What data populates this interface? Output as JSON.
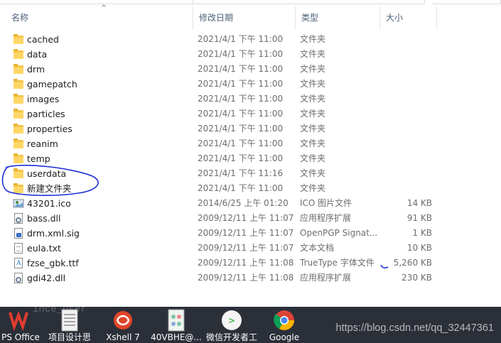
{
  "columns": {
    "name": "名称",
    "date": "修改日期",
    "type": "类型",
    "size": "大小"
  },
  "files": [
    {
      "name": "cached",
      "date": "2021/4/1 下午 11:00",
      "type": "文件夹",
      "size": "",
      "icon": "folder-icon"
    },
    {
      "name": "data",
      "date": "2021/4/1 下午 11:00",
      "type": "文件夹",
      "size": "",
      "icon": "folder-icon"
    },
    {
      "name": "drm",
      "date": "2021/4/1 下午 11:00",
      "type": "文件夹",
      "size": "",
      "icon": "folder-icon"
    },
    {
      "name": "gamepatch",
      "date": "2021/4/1 下午 11:00",
      "type": "文件夹",
      "size": "",
      "icon": "folder-icon"
    },
    {
      "name": "images",
      "date": "2021/4/1 下午 11:00",
      "type": "文件夹",
      "size": "",
      "icon": "folder-icon"
    },
    {
      "name": "particles",
      "date": "2021/4/1 下午 11:00",
      "type": "文件夹",
      "size": "",
      "icon": "folder-icon"
    },
    {
      "name": "properties",
      "date": "2021/4/1 下午 11:00",
      "type": "文件夹",
      "size": "",
      "icon": "folder-icon"
    },
    {
      "name": "reanim",
      "date": "2021/4/1 下午 11:00",
      "type": "文件夹",
      "size": "",
      "icon": "folder-icon"
    },
    {
      "name": "temp",
      "date": "2021/4/1 下午 11:00",
      "type": "文件夹",
      "size": "",
      "icon": "folder-icon"
    },
    {
      "name": "userdata",
      "date": "2021/4/1 下午 11:16",
      "type": "文件夹",
      "size": "",
      "icon": "folder-icon"
    },
    {
      "name": "新建文件夹",
      "date": "2021/4/1 下午 11:00",
      "type": "文件夹",
      "size": "",
      "icon": "folder-icon"
    },
    {
      "name": "43201.ico",
      "date": "2014/6/25 上午 01:20",
      "type": "ICO 图片文件",
      "size": "14 KB",
      "icon": "ico-file-icon"
    },
    {
      "name": "bass.dll",
      "date": "2009/12/11 上午 11:07",
      "type": "应用程序扩展",
      "size": "91 KB",
      "icon": "dll-file-icon"
    },
    {
      "name": "drm.xml.sig",
      "date": "2009/12/11 上午 11:07",
      "type": "OpenPGP Signat...",
      "size": "1 KB",
      "icon": "signature-file-icon"
    },
    {
      "name": "eula.txt",
      "date": "2009/12/11 上午 11:07",
      "type": "文本文档",
      "size": "10 KB",
      "icon": "text-file-icon"
    },
    {
      "name": "fzse_gbk.ttf",
      "date": "2009/12/11 上午 11:08",
      "type": "TrueType 字体文件",
      "size": "5,260 KB",
      "icon": "font-file-icon"
    },
    {
      "name": "gdi42.dll",
      "date": "2009/12/11 上午 11:08",
      "type": "应用程序扩展",
      "size": "230 KB",
      "icon": "dll-file-icon"
    }
  ],
  "taskbar": [
    {
      "label": "PS Office",
      "icon": "wps-office-icon",
      "color": "#e23c2f"
    },
    {
      "label": "项目设计思",
      "icon": "document-icon",
      "color": "#f2f2f2"
    },
    {
      "label": "Xshell 7",
      "icon": "xshell-icon",
      "color": "#e0452b"
    },
    {
      "label": "40VBHE@...",
      "icon": "app-icon",
      "color": "#7fc3a6"
    },
    {
      "label": "微信开发者工",
      "icon": "wechat-devtools-icon",
      "color": "#1aad19"
    },
    {
      "label": "Google",
      "icon": "chrome-icon",
      "color": "#4285f4"
    }
  ],
  "watermark": "https://blog.csdn.net/qq_32447361",
  "colors": {
    "header_text": "#4c607a",
    "folder": "#ffd766",
    "annotation": "#1f2fd6",
    "taskbar": "#2b2f38"
  }
}
